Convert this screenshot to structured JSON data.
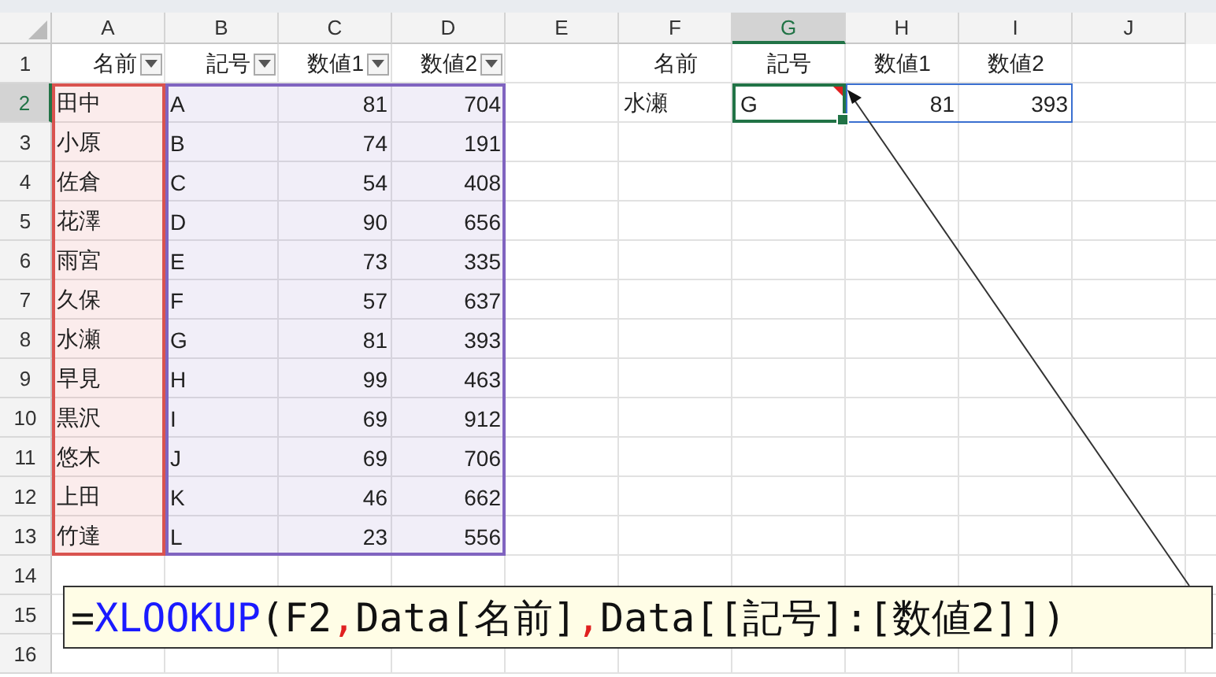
{
  "column_headers": [
    {
      "label": "A",
      "selected": false
    },
    {
      "label": "B",
      "selected": false
    },
    {
      "label": "C",
      "selected": false
    },
    {
      "label": "D",
      "selected": false
    },
    {
      "label": "E",
      "selected": false
    },
    {
      "label": "F",
      "selected": false
    },
    {
      "label": "G",
      "selected": true
    },
    {
      "label": "H",
      "selected": false
    },
    {
      "label": "I",
      "selected": false
    },
    {
      "label": "J",
      "selected": false
    }
  ],
  "row_headers": [
    {
      "label": "1",
      "selected": false
    },
    {
      "label": "2",
      "selected": true
    },
    {
      "label": "3",
      "selected": false
    },
    {
      "label": "4",
      "selected": false
    },
    {
      "label": "5",
      "selected": false
    },
    {
      "label": "6",
      "selected": false
    },
    {
      "label": "7",
      "selected": false
    },
    {
      "label": "8",
      "selected": false
    },
    {
      "label": "9",
      "selected": false
    },
    {
      "label": "10",
      "selected": false
    },
    {
      "label": "11",
      "selected": false
    },
    {
      "label": "12",
      "selected": false
    },
    {
      "label": "13",
      "selected": false
    },
    {
      "label": "14",
      "selected": false
    },
    {
      "label": "15",
      "selected": false
    },
    {
      "label": "16",
      "selected": false
    }
  ],
  "table": {
    "columns": [
      {
        "label": "名前",
        "color": "#d9534f"
      },
      {
        "label": "記号",
        "color": "#8064c0"
      },
      {
        "label": "数値1",
        "color": "#8064c0"
      },
      {
        "label": "数値2",
        "color": "#8064c0"
      }
    ],
    "rows": [
      [
        "田中",
        "A",
        "81",
        "704"
      ],
      [
        "小原",
        "B",
        "74",
        "191"
      ],
      [
        "佐倉",
        "C",
        "54",
        "408"
      ],
      [
        "花澤",
        "D",
        "90",
        "656"
      ],
      [
        "雨宮",
        "E",
        "73",
        "335"
      ],
      [
        "久保",
        "F",
        "57",
        "637"
      ],
      [
        "水瀬",
        "G",
        "81",
        "393"
      ],
      [
        "早見",
        "H",
        "99",
        "463"
      ],
      [
        "黒沢",
        "I",
        "69",
        "912"
      ],
      [
        "悠木",
        "J",
        "69",
        "706"
      ],
      [
        "上田",
        "K",
        "46",
        "662"
      ],
      [
        "竹達",
        "L",
        "23",
        "556"
      ]
    ]
  },
  "lookup": {
    "headers": [
      "名前",
      "記号",
      "数値1",
      "数値2"
    ],
    "cells": [
      {
        "text": "水瀬",
        "selected": false
      },
      {
        "text": "G",
        "selected": true
      },
      {
        "text": "81",
        "selected": false
      },
      {
        "text": "393",
        "selected": false
      }
    ]
  },
  "formula_callout": {
    "parts": [
      {
        "kind": "plain",
        "text": "="
      },
      {
        "kind": "function",
        "text": "XLOOKUP"
      },
      {
        "kind": "plain",
        "text": "(F2"
      },
      {
        "kind": "separator",
        "text": ","
      },
      {
        "kind": "plain",
        "text": "Data[名前]"
      },
      {
        "kind": "separator",
        "text": ","
      },
      {
        "kind": "plain",
        "text": "Data[[記号]:[数値2]])"
      }
    ]
  }
}
